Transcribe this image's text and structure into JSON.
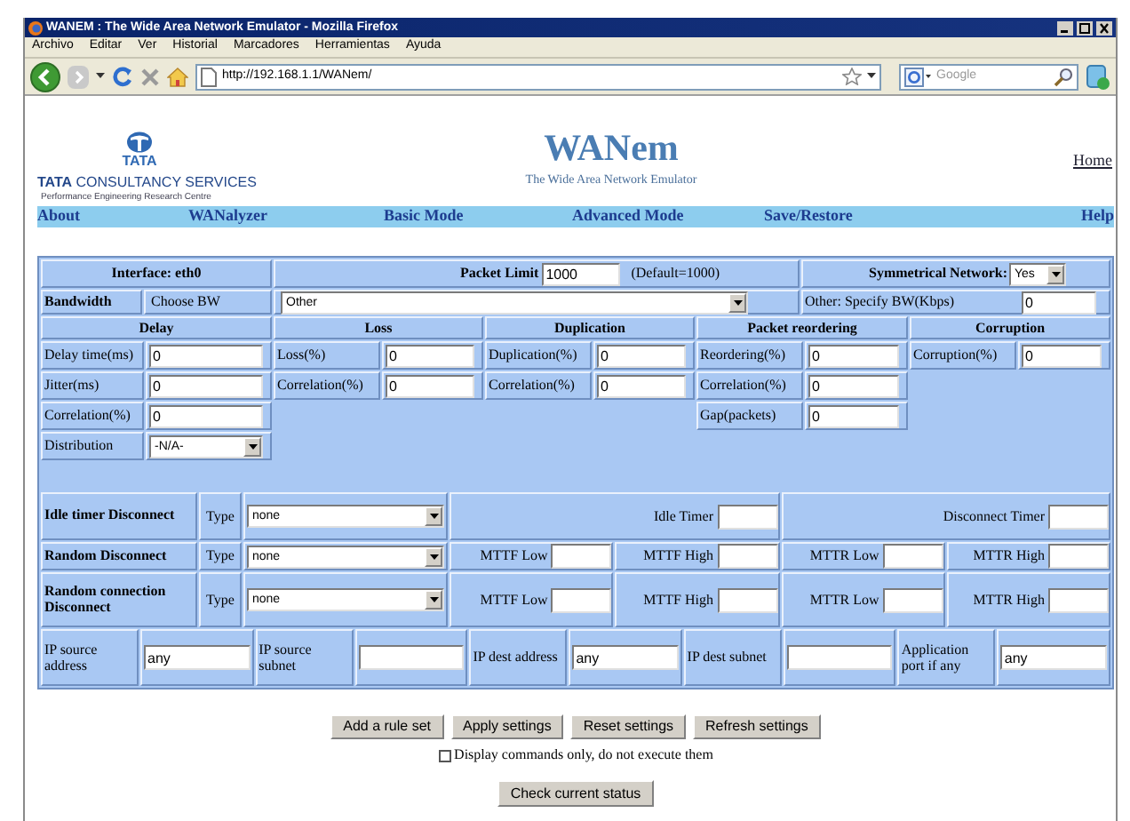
{
  "window": {
    "title": "WANEM : The Wide Area Network Emulator - Mozilla Firefox"
  },
  "menu": [
    "Archivo",
    "Editar",
    "Ver",
    "Historial",
    "Marcadores",
    "Herramientas",
    "Ayuda"
  ],
  "address": "http://192.168.1.1/WANem/",
  "search": {
    "placeholder": "Google"
  },
  "header": {
    "logo_text": "TATA",
    "org": "**TATA** CONSULTANCY SERVICES",
    "org_sub": "Performance Engineering Research Centre",
    "title": "WANem",
    "subtitle": "The Wide Area Network Emulator",
    "home_link": "Home"
  },
  "nav": [
    "About",
    "WANalyzer",
    "Basic Mode",
    "Advanced Mode",
    "Save/Restore",
    "Help"
  ],
  "form": {
    "interface": "Interface: eth0",
    "packet_limit": {
      "label": "Packet Limit",
      "value": "1000",
      "note": "(Default=1000)"
    },
    "symmetrical": {
      "label": "Symmetrical Network:",
      "value": "Yes"
    },
    "bandwidth": {
      "label": "Bandwidth",
      "choose": "Choose BW",
      "value": "Other",
      "other_label": "Other: Specify BW(Kbps)",
      "other_value": "0"
    },
    "groups": [
      {
        "title": "Delay",
        "fields": [
          {
            "kind": "text",
            "label": "Delay time(ms)",
            "value": "0"
          },
          {
            "kind": "text",
            "label": "Jitter(ms)",
            "value": "0"
          },
          {
            "kind": "text",
            "label": "Correlation(%)",
            "value": "0"
          },
          {
            "kind": "select",
            "label": "Distribution",
            "value": "-N/A-"
          }
        ]
      },
      {
        "title": "Loss",
        "fields": [
          {
            "kind": "text",
            "label": "Loss(%)",
            "value": "0"
          },
          {
            "kind": "text",
            "label": "Correlation(%)",
            "value": "0"
          }
        ]
      },
      {
        "title": "Duplication",
        "fields": [
          {
            "kind": "text",
            "label": "Duplication(%)",
            "value": "0"
          },
          {
            "kind": "text",
            "label": "Correlation(%)",
            "value": "0"
          }
        ]
      },
      {
        "title": "Packet reordering",
        "fields": [
          {
            "kind": "text",
            "label": "Reordering(%)",
            "value": "0"
          },
          {
            "kind": "text",
            "label": "Correlation(%)",
            "value": "0"
          },
          {
            "kind": "text",
            "label": "Gap(packets)",
            "value": "0"
          }
        ]
      },
      {
        "title": "Corruption",
        "fields": [
          {
            "kind": "text",
            "label": "Corruption(%)",
            "value": "0"
          }
        ]
      }
    ],
    "disconnects": [
      {
        "title": "Idle timer Disconnect",
        "type_label": "Type",
        "type": "none",
        "fields": [
          {
            "label": "Idle Timer"
          },
          {
            "label": "Disconnect Timer"
          }
        ]
      },
      {
        "title": "Random Disconnect",
        "type_label": "Type",
        "type": "none",
        "fields": [
          {
            "label": "MTTF Low"
          },
          {
            "label": "MTTF High"
          },
          {
            "label": "MTTR Low"
          },
          {
            "label": "MTTR High"
          }
        ]
      },
      {
        "title": "Random connection Disconnect",
        "type_label": "Type",
        "type": "none",
        "fields": [
          {
            "label": "MTTF Low"
          },
          {
            "label": "MTTF High"
          },
          {
            "label": "MTTR Low"
          },
          {
            "label": "MTTR High"
          }
        ]
      }
    ],
    "ip_filters": [
      {
        "label": "IP source address",
        "value": "any"
      },
      {
        "label": "IP source subnet"
      },
      {
        "label": "IP dest address",
        "value": "any"
      },
      {
        "label": "IP dest subnet"
      },
      {
        "label": "Application port if any",
        "value": "any"
      }
    ]
  },
  "buttons": [
    "Add a rule set",
    "Apply settings",
    "Reset settings",
    "Refresh settings"
  ],
  "display_only": {
    "label": "Display commands only, do not execute them",
    "checked": false
  },
  "status_button": "Check current status"
}
